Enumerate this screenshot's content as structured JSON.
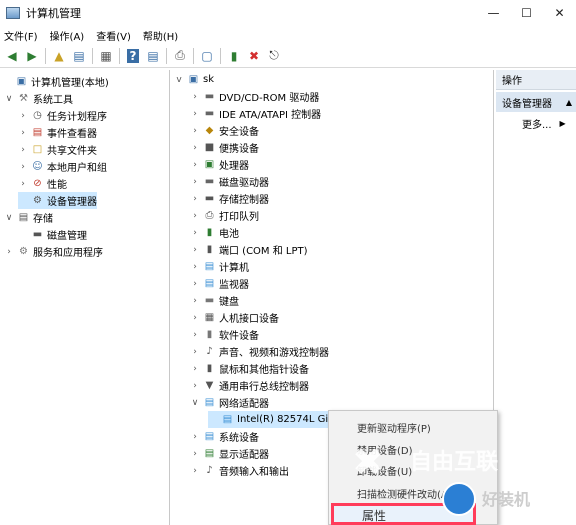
{
  "window": {
    "title": "计算机管理"
  },
  "menu": [
    "文件(F)",
    "操作(A)",
    "查看(V)",
    "帮助(H)"
  ],
  "left_tree": [
    {
      "label": "计算机管理(本地)",
      "icon": "computer-management-icon",
      "indent": 0,
      "expander": ""
    },
    {
      "label": "系统工具",
      "icon": "system-tools-icon",
      "indent": 1,
      "expander": "v"
    },
    {
      "label": "任务计划程序",
      "icon": "task-scheduler-icon",
      "indent": 2,
      "expander": ">"
    },
    {
      "label": "事件查看器",
      "icon": "event-viewer-icon",
      "indent": 2,
      "expander": ">"
    },
    {
      "label": "共享文件夹",
      "icon": "shared-folders-icon",
      "indent": 2,
      "expander": ">"
    },
    {
      "label": "本地用户和组",
      "icon": "users-groups-icon",
      "indent": 2,
      "expander": ">"
    },
    {
      "label": "性能",
      "icon": "performance-icon",
      "indent": 2,
      "expander": ">"
    },
    {
      "label": "设备管理器",
      "icon": "device-manager-icon",
      "indent": 2,
      "expander": "",
      "selected": true
    },
    {
      "label": "存储",
      "icon": "storage-icon",
      "indent": 1,
      "expander": "v"
    },
    {
      "label": "磁盘管理",
      "icon": "disk-management-icon",
      "indent": 2,
      "expander": ""
    },
    {
      "label": "服务和应用程序",
      "icon": "services-apps-icon",
      "indent": 1,
      "expander": ">"
    }
  ],
  "device_tree": {
    "root": "sk",
    "items": [
      {
        "label": "DVD/CD-ROM 驱动器",
        "icon": "dvd-drive-icon",
        "expander": ">"
      },
      {
        "label": "IDE ATA/ATAPI 控制器",
        "icon": "ide-controller-icon",
        "expander": ">"
      },
      {
        "label": "安全设备",
        "icon": "security-device-icon",
        "expander": ">"
      },
      {
        "label": "便携设备",
        "icon": "portable-device-icon",
        "expander": ">"
      },
      {
        "label": "处理器",
        "icon": "processor-icon",
        "expander": ">"
      },
      {
        "label": "磁盘驱动器",
        "icon": "disk-drive-icon",
        "expander": ">"
      },
      {
        "label": "存储控制器",
        "icon": "storage-controller-icon",
        "expander": ">"
      },
      {
        "label": "打印队列",
        "icon": "print-queue-icon",
        "expander": ">"
      },
      {
        "label": "电池",
        "icon": "battery-icon",
        "expander": ">"
      },
      {
        "label": "端口 (COM 和 LPT)",
        "icon": "port-icon",
        "expander": ">"
      },
      {
        "label": "计算机",
        "icon": "computer-icon",
        "expander": ">"
      },
      {
        "label": "监视器",
        "icon": "monitor-icon",
        "expander": ">"
      },
      {
        "label": "键盘",
        "icon": "keyboard-icon",
        "expander": ">"
      },
      {
        "label": "人机接口设备",
        "icon": "hid-icon",
        "expander": ">"
      },
      {
        "label": "软件设备",
        "icon": "software-device-icon",
        "expander": ">"
      },
      {
        "label": "声音、视频和游戏控制器",
        "icon": "sound-icon",
        "expander": ">"
      },
      {
        "label": "鼠标和其他指针设备",
        "icon": "mouse-icon",
        "expander": ">"
      },
      {
        "label": "通用串行总线控制器",
        "icon": "usb-icon",
        "expander": ">"
      },
      {
        "label": "网络适配器",
        "icon": "network-adapter-icon",
        "expander": "v"
      },
      {
        "label": "Intel(R) 82574L Gi",
        "icon": "network-card-icon",
        "expander": "",
        "child": true,
        "selected": true
      },
      {
        "label": "系统设备",
        "icon": "system-device-icon",
        "expander": ">"
      },
      {
        "label": "显示适配器",
        "icon": "display-adapter-icon",
        "expander": ">"
      },
      {
        "label": "音频输入和输出",
        "icon": "audio-io-icon",
        "expander": ">"
      }
    ]
  },
  "actions": {
    "header": "操作",
    "section": "设备管理器",
    "more": "更多..."
  },
  "context_menu": {
    "items": [
      "更新驱动程序(P)",
      "禁用设备(D)",
      "卸载设备(U)",
      "扫描检测硬件改动(A)"
    ],
    "properties": "属性"
  },
  "watermark": {
    "brand": "自由互联",
    "secondary": "好装机"
  }
}
